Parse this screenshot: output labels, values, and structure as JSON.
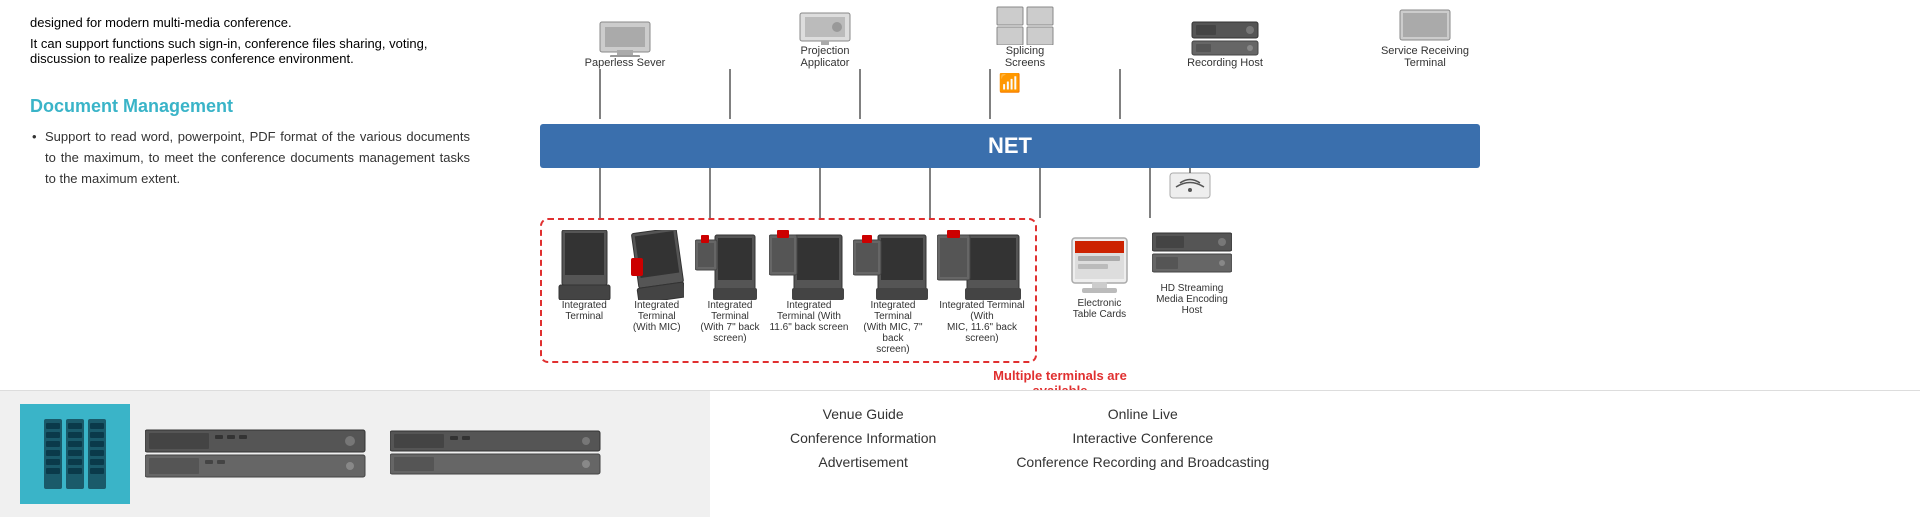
{
  "left": {
    "intro_text": "designed for modern multi-media conference.",
    "intro_text2": "It can support functions such sign-in, conference files sharing, voting, discussion to realize paperless conference environment.",
    "doc_title": "Document Management",
    "bullet": "Support to read word, powerpoint, PDF format of the various documents to the maximum, to meet the conference documents management tasks to the maximum extent."
  },
  "diagram": {
    "net_label": "NET",
    "top_devices": [
      {
        "label": "Paperless Sever"
      },
      {
        "label": "Projection\nApplicator"
      },
      {
        "label": "Splicing\nScreens"
      },
      {
        "label": "Recording Host"
      },
      {
        "label": "Service Receiving\nTerminal"
      }
    ],
    "terminals": [
      {
        "label": "Integrated\nTerminal"
      },
      {
        "label": "Integrated\nTerminal\n(With MIC)"
      },
      {
        "label": "Integrated\nTerminal\n(With 7\" back\nscreen)"
      },
      {
        "label": "Integrated\nTerminal (With\n11.6\" back screen\n)"
      },
      {
        "label": "Integrated Terminal\n(With MIC, 7\" back\nscreen)"
      },
      {
        "label": "Integrated Terminal (With\nMIC, 11.6\" back screen)"
      }
    ],
    "multiple_terminals_text": "Multiple terminals are\navailable",
    "extra_devices": [
      {
        "label": "Electronic\nTable Cards"
      },
      {
        "label": "HD Streaming\nMedia Encoding\nHost"
      }
    ]
  },
  "bottom": {
    "left_devices": [
      {
        "label": ""
      },
      {
        "label": ""
      },
      {
        "label": ""
      }
    ],
    "right_cols": [
      {
        "items": [
          "Venue Guide",
          "Conference Information",
          "Advertisement"
        ]
      },
      {
        "items": [
          "Online Live",
          "Interactive Conference",
          "Conference Recording and Broadcasting"
        ]
      }
    ]
  }
}
